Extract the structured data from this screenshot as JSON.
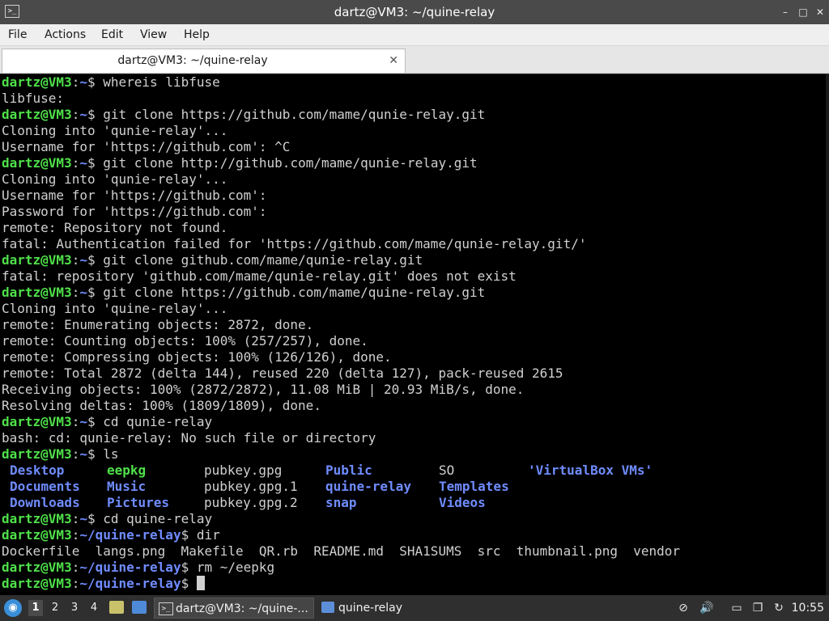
{
  "window": {
    "title": "dartz@VM3: ~/quine-relay",
    "app_icon": ">_",
    "controls": {
      "minimize": "–",
      "maximize": "□",
      "close": "✕"
    }
  },
  "menu": {
    "file": "File",
    "actions": "Actions",
    "edit": "Edit",
    "view": "View",
    "help": "Help"
  },
  "tab": {
    "label": "dartz@VM3: ~/quine-relay",
    "close": "✕"
  },
  "terminal": {
    "user": "dartz@VM3",
    "lines": [
      {
        "type": "cmd",
        "path": "~",
        "cmd": "whereis libfuse"
      },
      {
        "type": "out",
        "text": "libfuse:"
      },
      {
        "type": "cmd",
        "path": "~",
        "cmd": "git clone https://github.com/mame/qunie-relay.git"
      },
      {
        "type": "out",
        "text": "Cloning into 'qunie-relay'..."
      },
      {
        "type": "out",
        "text": "Username for 'https://github.com': ^C"
      },
      {
        "type": "cmd",
        "path": "~",
        "cmd": "git clone http://github.com/mame/qunie-relay.git"
      },
      {
        "type": "out",
        "text": "Cloning into 'qunie-relay'..."
      },
      {
        "type": "out",
        "text": "Username for 'https://github.com':"
      },
      {
        "type": "out",
        "text": "Password for 'https://github.com':"
      },
      {
        "type": "out",
        "text": "remote: Repository not found."
      },
      {
        "type": "out",
        "text": "fatal: Authentication failed for 'https://github.com/mame/qunie-relay.git/'"
      },
      {
        "type": "cmd",
        "path": "~",
        "cmd": "git clone github.com/mame/qunie-relay.git"
      },
      {
        "type": "out",
        "text": "fatal: repository 'github.com/mame/qunie-relay.git' does not exist"
      },
      {
        "type": "cmd",
        "path": "~",
        "cmd": "git clone https://github.com/mame/quine-relay.git"
      },
      {
        "type": "out",
        "text": "Cloning into 'quine-relay'..."
      },
      {
        "type": "out",
        "text": "remote: Enumerating objects: 2872, done."
      },
      {
        "type": "out",
        "text": "remote: Counting objects: 100% (257/257), done."
      },
      {
        "type": "out",
        "text": "remote: Compressing objects: 100% (126/126), done."
      },
      {
        "type": "out",
        "text": "remote: Total 2872 (delta 144), reused 220 (delta 127), pack-reused 2615"
      },
      {
        "type": "out",
        "text": "Receiving objects: 100% (2872/2872), 11.08 MiB | 20.93 MiB/s, done."
      },
      {
        "type": "out",
        "text": "Resolving deltas: 100% (1809/1809), done."
      },
      {
        "type": "cmd",
        "path": "~",
        "cmd": "cd qunie-relay"
      },
      {
        "type": "out",
        "text": "bash: cd: qunie-relay: No such file or directory"
      },
      {
        "type": "cmd",
        "path": "~",
        "cmd": "ls"
      },
      {
        "type": "ls",
        "items": [
          {
            "text": "Desktop",
            "kind": "dir"
          },
          {
            "text": "eepkg",
            "kind": "exe"
          },
          {
            "text": "pubkey.gpg",
            "kind": "file"
          },
          {
            "text": "Public",
            "kind": "dir"
          },
          {
            "text": "SO",
            "kind": "file"
          },
          {
            "text": "'VirtualBox VMs'",
            "kind": "dir"
          }
        ]
      },
      {
        "type": "ls",
        "items": [
          {
            "text": "Documents",
            "kind": "dir"
          },
          {
            "text": "Music",
            "kind": "dir"
          },
          {
            "text": "pubkey.gpg.1",
            "kind": "file"
          },
          {
            "text": "quine-relay",
            "kind": "dir"
          },
          {
            "text": "Templates",
            "kind": "dir"
          }
        ]
      },
      {
        "type": "ls",
        "items": [
          {
            "text": "Downloads",
            "kind": "dir"
          },
          {
            "text": "Pictures",
            "kind": "dir"
          },
          {
            "text": "pubkey.gpg.2",
            "kind": "file"
          },
          {
            "text": "snap",
            "kind": "dir"
          },
          {
            "text": "Videos",
            "kind": "dir"
          }
        ]
      },
      {
        "type": "cmd",
        "path": "~",
        "cmd": "cd quine-relay"
      },
      {
        "type": "cmd",
        "path": "~/quine-relay",
        "cmd": "dir"
      },
      {
        "type": "out",
        "text": "Dockerfile  langs.png  Makefile  QR.rb  README.md  SHA1SUMS  src  thumbnail.png  vendor"
      },
      {
        "type": "cmd",
        "path": "~/quine-relay",
        "cmd": "rm ~/eepkg"
      },
      {
        "type": "cmd",
        "path": "~/quine-relay",
        "cmd": "",
        "cursor": true
      }
    ]
  },
  "taskbar": {
    "workspaces": [
      "1",
      "2",
      "3",
      "4"
    ],
    "tasks": [
      {
        "label": "dartz@VM3: ~/quine-...",
        "icon": ">_"
      },
      {
        "label": "quine-relay",
        "icon": ""
      }
    ],
    "tray": {
      "pin": "⊘",
      "volume": "🔊",
      "network": "▭",
      "clipboard": "❐",
      "update": "↻"
    },
    "clock": "10:55"
  },
  "colors": {
    "prompt_user": "#4fe04a",
    "prompt_path": "#6f8cff",
    "terminal_bg": "#000000",
    "terminal_fg": "#d0d0d0"
  }
}
